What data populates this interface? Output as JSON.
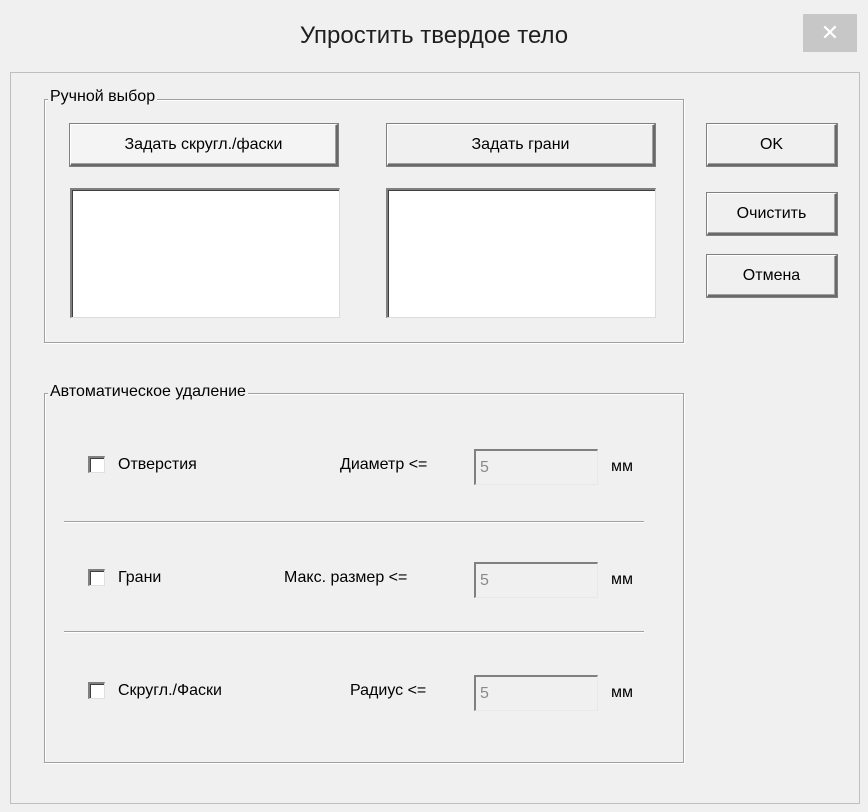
{
  "window": {
    "title": "Упростить твердое тело",
    "close_glyph": "✕"
  },
  "manual": {
    "legend": "Ручной выбор",
    "fillets_button": "Задать скругл./фаски",
    "faces_button": "Задать грани"
  },
  "actions": {
    "ok": "OK",
    "clear": "Очистить",
    "cancel": "Отмена"
  },
  "auto": {
    "legend": "Автоматическое удаление",
    "rows": [
      {
        "checkbox_label": "Отверстия",
        "param_label": "Диаметр <=",
        "value": "5",
        "unit": "мм",
        "checked": false
      },
      {
        "checkbox_label": "Грани",
        "param_label": "Макс. размер <=",
        "value": "5",
        "unit": "мм",
        "checked": false
      },
      {
        "checkbox_label": "Скругл./Фаски",
        "param_label": "Радиус <=",
        "value": "5",
        "unit": "мм",
        "checked": false
      }
    ]
  }
}
